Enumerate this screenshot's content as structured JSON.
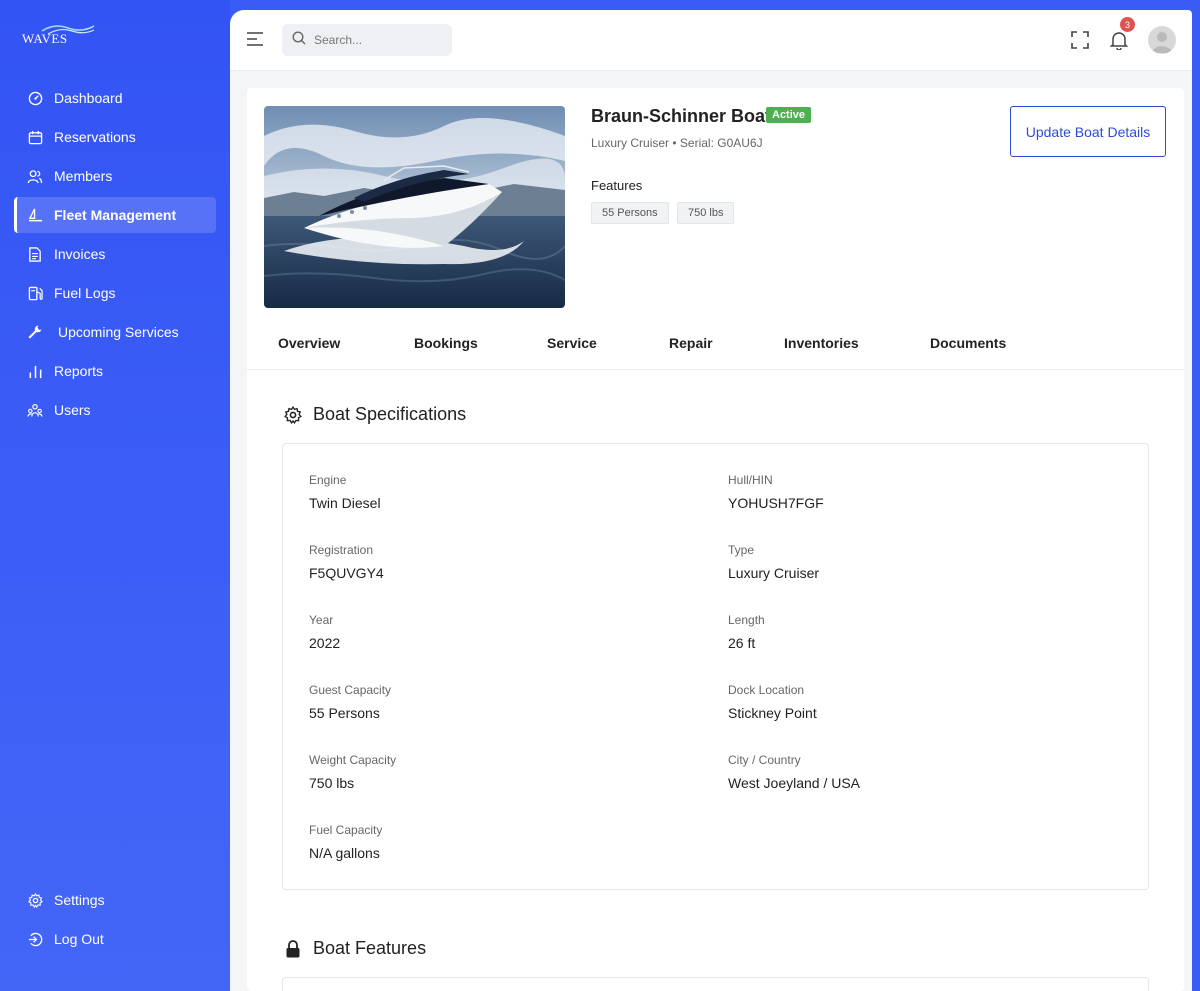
{
  "brand": {
    "logo_text": "WAVES"
  },
  "sidebar": {
    "items": [
      {
        "label": "Dashboard",
        "icon": "dashboard-icon"
      },
      {
        "label": "Reservations",
        "icon": "calendar-icon"
      },
      {
        "label": "Members",
        "icon": "members-icon"
      },
      {
        "label": "Fleet Management",
        "icon": "sailboat-icon",
        "active": true
      },
      {
        "label": "Invoices",
        "icon": "invoice-icon"
      },
      {
        "label": "Fuel Logs",
        "icon": "fuel-icon"
      },
      {
        "label": "Upcoming Services",
        "icon": "wrench-icon"
      },
      {
        "label": "Reports",
        "icon": "bar-chart-icon"
      },
      {
        "label": "Users",
        "icon": "users-icon"
      }
    ],
    "bottom": [
      {
        "label": "Settings",
        "icon": "gear-icon"
      },
      {
        "label": "Log Out",
        "icon": "logout-icon"
      }
    ]
  },
  "topbar": {
    "search_placeholder": "Search...",
    "notification_count": "3"
  },
  "boat": {
    "name": "Braun-Schinner Boat",
    "status": "Active",
    "subtitle": "Luxury Cruiser • Serial: G0AU6J",
    "features_label": "Features",
    "chips": [
      "55 Persons",
      "750 lbs"
    ],
    "update_label": "Update Boat Details"
  },
  "tabs": [
    "Overview",
    "Bookings",
    "Service",
    "Repair",
    "Inventories",
    "Documents"
  ],
  "specs": {
    "title": "Boat Specifications",
    "left": [
      {
        "label": "Engine",
        "value": "Twin Diesel"
      },
      {
        "label": "Registration",
        "value": "F5QUVGY4"
      },
      {
        "label": "Year",
        "value": "2022"
      },
      {
        "label": "Guest Capacity",
        "value": "55 Persons"
      },
      {
        "label": "Weight Capacity",
        "value": "750 lbs"
      },
      {
        "label": "Fuel Capacity",
        "value": "N/A gallons"
      }
    ],
    "right": [
      {
        "label": "Hull/HIN",
        "value": "YOHUSH7FGF"
      },
      {
        "label": "Type",
        "value": "Luxury Cruiser"
      },
      {
        "label": "Length",
        "value": "26 ft"
      },
      {
        "label": "Dock Location",
        "value": "Stickney Point"
      },
      {
        "label": "City / Country",
        "value": "West Joeyland / USA"
      }
    ]
  },
  "features_section": {
    "title": "Boat Features"
  },
  "colors": {
    "sidebar": "#3354f4",
    "accent": "#2d4cd8",
    "active_badge": "#4caf50",
    "notification": "#e0524f"
  }
}
